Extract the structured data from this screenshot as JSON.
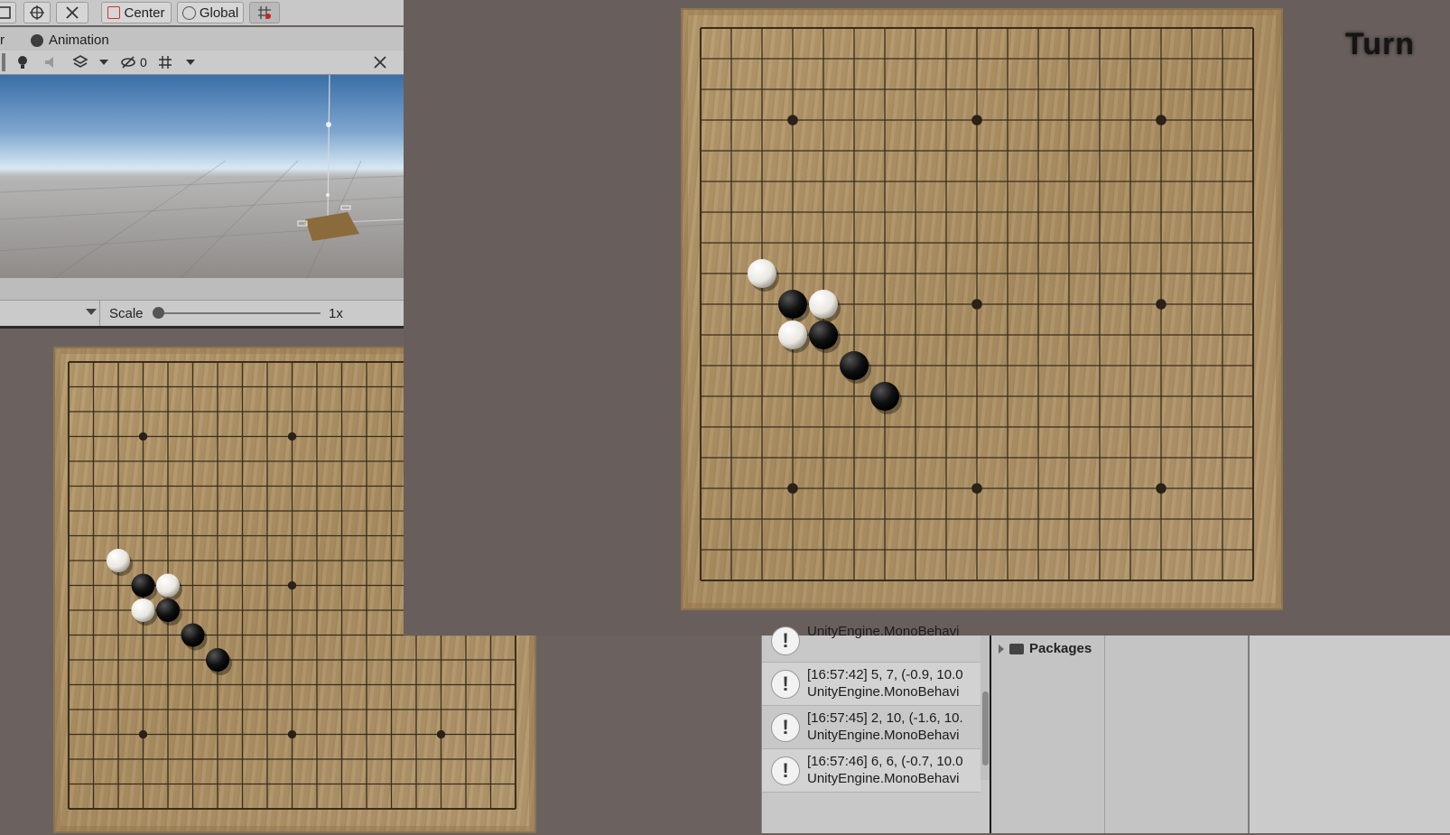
{
  "toolbar": {
    "pivot_label": "Center",
    "space_label": "Global"
  },
  "tabs": {
    "animation_label": "Animation",
    "cut_label": "r"
  },
  "scene_toolbar": {
    "hidden_count": "0"
  },
  "scale": {
    "label": "Scale",
    "value": "1x",
    "slider_fraction": 0.0
  },
  "game": {
    "turn_label": "Turn",
    "board_size": 19,
    "star_points": [
      [
        3,
        3
      ],
      [
        9,
        3
      ],
      [
        15,
        3
      ],
      [
        9,
        9
      ],
      [
        15,
        9
      ],
      [
        3,
        15
      ],
      [
        9,
        15
      ],
      [
        15,
        15
      ]
    ],
    "left_star_points": [
      [
        3,
        3
      ],
      [
        9,
        3
      ],
      [
        9,
        9
      ],
      [
        3,
        15
      ],
      [
        9,
        15
      ],
      [
        15,
        15
      ]
    ],
    "stones": [
      {
        "col": 2,
        "row": 8,
        "color": "white"
      },
      {
        "col": 3,
        "row": 9,
        "color": "black"
      },
      {
        "col": 4,
        "row": 9,
        "color": "white"
      },
      {
        "col": 3,
        "row": 10,
        "color": "white"
      },
      {
        "col": 4,
        "row": 10,
        "color": "black"
      },
      {
        "col": 5,
        "row": 11,
        "color": "black"
      },
      {
        "col": 6,
        "row": 12,
        "color": "black"
      }
    ]
  },
  "console": {
    "rows": [
      {
        "line1": "",
        "line2": "UnityEngine.MonoBehavi"
      },
      {
        "line1": "[16:57:42] 5, 7, (-0.9, 10.0",
        "line2": "UnityEngine.MonoBehavi"
      },
      {
        "line1": "[16:57:45] 2, 10, (-1.6, 10.",
        "line2": "UnityEngine.MonoBehavi"
      },
      {
        "line1": "[16:57:46] 6, 6, (-0.7, 10.0",
        "line2": "UnityEngine.MonoBehavi"
      }
    ]
  },
  "project": {
    "packages_label": "Packages"
  },
  "colors": {
    "board": "#b0946a",
    "grid_line": "#3a2d1c",
    "black_stone": "#111111",
    "white_stone": "#e8e6df",
    "background": "#685f5c"
  }
}
